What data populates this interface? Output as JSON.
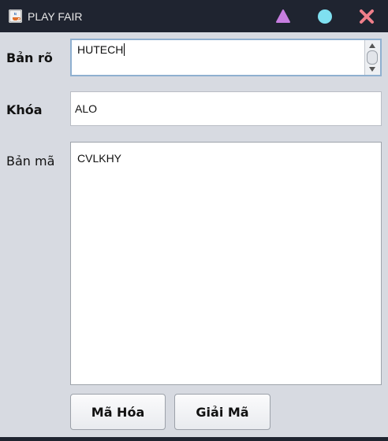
{
  "window": {
    "title": "PLAY FAIR",
    "controls": {
      "minimize_icon": "triangle-icon",
      "maximize_icon": "circle-icon",
      "close_icon": "x-icon"
    },
    "colors": {
      "titlebar": "#1f2430",
      "minimize": "#c77ee0",
      "maximize": "#7fe0f0",
      "close": "#f07f8a",
      "content_bg": "#d7dae1"
    }
  },
  "form": {
    "plaintext_label": "Bản rõ",
    "plaintext_value": "HUTECH",
    "key_label": "Khóa",
    "key_value": "ALO",
    "ciphertext_label": "Bản mã",
    "ciphertext_value": "CVLKHY"
  },
  "buttons": {
    "encrypt": "Mã Hóa",
    "decrypt": "Giải Mã"
  }
}
